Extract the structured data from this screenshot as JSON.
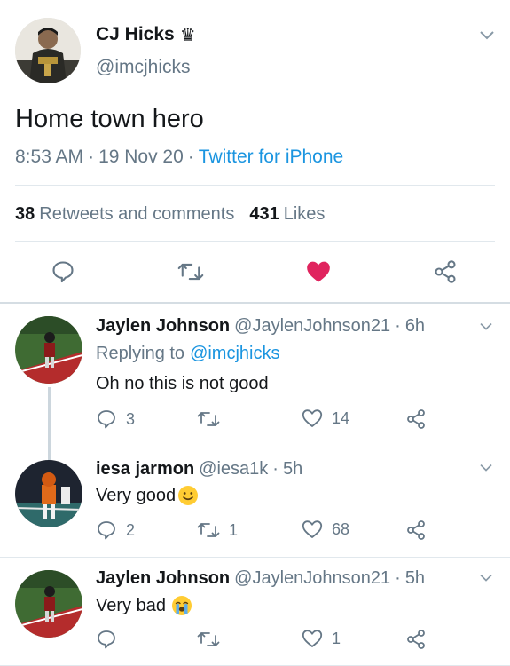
{
  "main_tweet": {
    "author_name": "CJ Hicks",
    "author_badge": "♛",
    "handle": "@imcjhicks",
    "text": "Home town hero",
    "time": "8:53 AM",
    "sep1": "·",
    "date": "19 Nov 20",
    "sep2": "·",
    "source": "Twitter for iPhone",
    "retweets_count": "38",
    "retweets_label": "Retweets and comments",
    "likes_count": "431",
    "likes_label": "Likes",
    "colors": {
      "like_active": "#e0245e",
      "link": "#1b95e0"
    }
  },
  "replies": [
    {
      "name": "Jaylen Johnson",
      "handle": "@JaylenJohnson21",
      "sep": "·",
      "time": "6h",
      "replying_prefix": "Replying to",
      "replying_to": "@imcjhicks",
      "text": "Oh no this is not good",
      "reply_count": "3",
      "retweet_count": "",
      "like_count": "14"
    },
    {
      "name": "iesa jarmon",
      "handle": "@iesa1k",
      "sep": "·",
      "time": "5h",
      "text": "Very good",
      "emoji": "🙂",
      "reply_count": "2",
      "retweet_count": "1",
      "like_count": "68"
    },
    {
      "name": "Jaylen Johnson",
      "handle": "@JaylenJohnson21",
      "sep": "·",
      "time": "5h",
      "text": "Very bad",
      "emoji": "😭",
      "reply_count": "",
      "retweet_count": "",
      "like_count": "1"
    }
  ]
}
